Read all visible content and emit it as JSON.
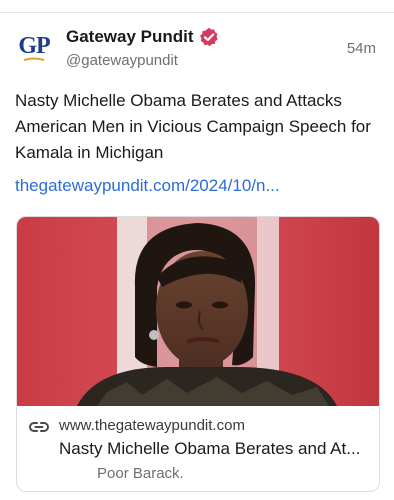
{
  "author": {
    "display_name": "Gateway Pundit",
    "handle": "@gatewaypundit",
    "avatar_text": "GP",
    "verified_color": "#d63a5e"
  },
  "post": {
    "time": "54m",
    "text": "Nasty Michelle Obama Berates and Attacks American Men in Vicious Campaign Speech for Kamala in Michigan",
    "link": "thegatewaypundit.com/2024/10/n...",
    "link_color": "#2e6bd6"
  },
  "link_card": {
    "domain": "www.thegatewaypundit.com",
    "title": "Nasty Michelle Obama Berates and At...",
    "description": "Poor Barack.",
    "icon": "link-icon"
  }
}
